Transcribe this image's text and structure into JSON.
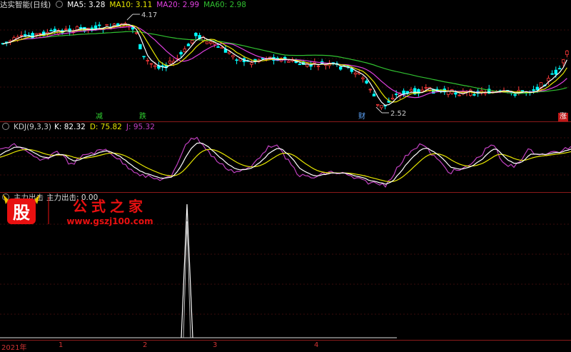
{
  "main": {
    "legend": {
      "title": "达实智能(日线)",
      "ma5": "MA5: 3.28",
      "ma10": "MA10: 3.11",
      "ma20": "MA20: 2.99",
      "ma60": "MA60: 2.98"
    },
    "colors": {
      "ma5": "#ffffff",
      "ma10": "#e6e600",
      "ma20": "#e040e0",
      "ma60": "#30c030",
      "up": "#ff3a3a",
      "down": "#00ffff"
    },
    "high_label": "4.17",
    "low_label": "2.52",
    "markers": {
      "m1": "减",
      "m2": "跌",
      "m3": "财",
      "m4": "涨"
    }
  },
  "kdj": {
    "legend": {
      "name": "KDJ(9,3,3)",
      "k": "K: 82.32",
      "d": "D: 75.82",
      "j": "J: 95.32"
    },
    "colors": {
      "k": "#ffffff",
      "d": "#e6e600",
      "j": "#c040c0"
    }
  },
  "indicator": {
    "legend": {
      "name": "主力出击",
      "value": "主力出击: 0.00"
    }
  },
  "xaxis": {
    "labels": [
      "2021年",
      "1",
      "2",
      "3",
      "4"
    ]
  },
  "watermark": {
    "logo": "股",
    "brand": "公式之家",
    "url": "www.gszj100.com"
  }
}
